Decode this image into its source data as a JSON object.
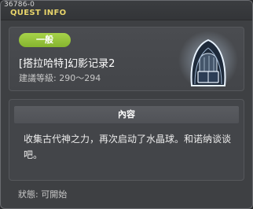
{
  "window": {
    "quest_id": "36786-0",
    "title": "QUEST INFO"
  },
  "quest": {
    "category": "一般",
    "name": "[搭拉哈特]幻影记录2",
    "level": "建議等級: 290～294",
    "content_header": "內容",
    "description": "收集古代神之力，再次启动了水晶球。和诺纳谈谈吧。",
    "status": "狀態: 可開始"
  },
  "colors": {
    "title": "#e8d46a",
    "category_badge": "#9acb40",
    "panel": "#3e4043"
  },
  "icons": {
    "npc": "hooded-figure-portrait"
  }
}
